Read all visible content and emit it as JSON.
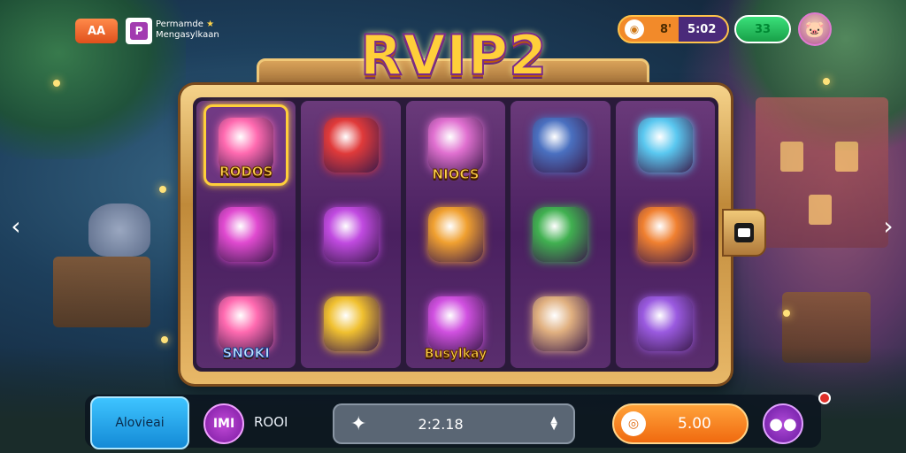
{
  "top_bar": {
    "badge": "AA",
    "logo_icon": "app-logo-icon",
    "promo_line1": "Permamde",
    "promo_line2": "Mengasylkaan",
    "balance_primary": "8'",
    "balance_secondary": "5:02",
    "green_value": "33",
    "avatar_icon": "avatar-icon"
  },
  "title": "RVIP2",
  "reels": [
    [
      {
        "label": "RODOS",
        "icon": "bird-disk-icon",
        "selected": true,
        "color": "#ff6ab0"
      },
      {
        "label": "",
        "icon": "pink-lantern-icon",
        "color": "#e04ad0"
      },
      {
        "label": "SNOKI",
        "icon": "bird-lemon-icon",
        "color": "#ff6ab0"
      }
    ],
    [
      {
        "label": "",
        "icon": "apple-basket-icon",
        "color": "#e03a3a"
      },
      {
        "label": "",
        "icon": "pink-spool-icon",
        "color": "#c04ae0"
      },
      {
        "label": "",
        "icon": "gold-roll-icon",
        "color": "#f0c030"
      }
    ],
    [
      {
        "label": "NIOCS",
        "icon": "ghost-card-icon",
        "color": "#e070d0"
      },
      {
        "label": "",
        "icon": "candy-icon",
        "color": "#f0a030"
      },
      {
        "label": "Busylkay",
        "icon": "magic-box-icon",
        "color": "#d050e0"
      }
    ],
    [
      {
        "label": "",
        "icon": "blue-cannon-icon",
        "color": "#4a70c0"
      },
      {
        "label": "",
        "icon": "fruit-bowl-icon",
        "color": "#40b050"
      },
      {
        "label": "",
        "icon": "pod-creature-icon",
        "color": "#e0b080"
      }
    ],
    [
      {
        "label": "",
        "icon": "blue-star-icon",
        "color": "#5ac8f0"
      },
      {
        "label": "",
        "icon": "orange-lantern-icon",
        "color": "#f08030"
      },
      {
        "label": "",
        "icon": "purple-gem-icon",
        "color": "#9a5ae0"
      }
    ]
  ],
  "bottom_bar": {
    "auto_label": "Alovieai",
    "menu_badge": "IMI",
    "room_label": "ROOI",
    "bet_value": "2:2.18",
    "spin_value": "5.00"
  }
}
